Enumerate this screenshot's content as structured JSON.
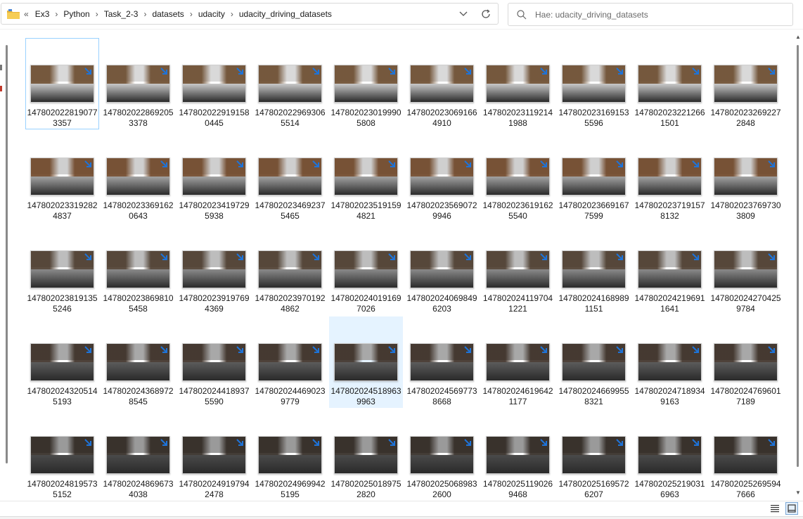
{
  "address_bar": {
    "back_label": "«",
    "crumbs": [
      "Ex3",
      "Python",
      "Task_2-3",
      "datasets",
      "udacity",
      "udacity_driving_datasets"
    ]
  },
  "search": {
    "placeholder": "Hae: udacity_driving_datasets"
  },
  "icons": {
    "folder": "folder-icon",
    "chevron": "chevron-down-icon",
    "refresh": "refresh-icon",
    "search": "search-icon",
    "shortcut": "shortcut-arrow-icon",
    "details_view": "details-view-icon",
    "thumbnail_view": "thumbnail-view-icon"
  },
  "colors": {
    "accent": "#1e73d8",
    "focus_border": "#99d1ff",
    "selection_bg": "#e5f3ff"
  },
  "files": [
    {
      "line1": "147802022819077",
      "line2": "3357"
    },
    {
      "line1": "147802022869205",
      "line2": "3378"
    },
    {
      "line1": "147802022919158",
      "line2": "0445"
    },
    {
      "line1": "147802022969306",
      "line2": "5514"
    },
    {
      "line1": "147802023019990",
      "line2": "5808"
    },
    {
      "line1": "147802023069166",
      "line2": "4910"
    },
    {
      "line1": "147802023119214",
      "line2": "1988"
    },
    {
      "line1": "147802023169153",
      "line2": "5596"
    },
    {
      "line1": "147802023221266",
      "line2": "1501"
    },
    {
      "line1": "147802023269227",
      "line2": "2848"
    },
    {
      "line1": "147802023319282",
      "line2": "4837"
    },
    {
      "line1": "147802023369162",
      "line2": "0643"
    },
    {
      "line1": "147802023419729",
      "line2": "5938"
    },
    {
      "line1": "147802023469237",
      "line2": "5465"
    },
    {
      "line1": "147802023519159",
      "line2": "4821"
    },
    {
      "line1": "147802023569072",
      "line2": "9946"
    },
    {
      "line1": "147802023619162",
      "line2": "5540"
    },
    {
      "line1": "147802023669167",
      "line2": "7599"
    },
    {
      "line1": "147802023719157",
      "line2": "8132"
    },
    {
      "line1": "147802023769730",
      "line2": "3809"
    },
    {
      "line1": "147802023819135",
      "line2": "5246"
    },
    {
      "line1": "147802023869810",
      "line2": "5458"
    },
    {
      "line1": "147802023919769",
      "line2": "4369"
    },
    {
      "line1": "147802023970192",
      "line2": "4862"
    },
    {
      "line1": "147802024019169",
      "line2": "7026"
    },
    {
      "line1": "147802024069849",
      "line2": "6203"
    },
    {
      "line1": "147802024119704",
      "line2": "1221"
    },
    {
      "line1": "147802024168989",
      "line2": "1151"
    },
    {
      "line1": "147802024219691",
      "line2": "1641"
    },
    {
      "line1": "147802024270425",
      "line2": "9784"
    },
    {
      "line1": "147802024320514",
      "line2": "5193"
    },
    {
      "line1": "147802024368972",
      "line2": "8545"
    },
    {
      "line1": "147802024418937",
      "line2": "5590"
    },
    {
      "line1": "147802024469023",
      "line2": "9779"
    },
    {
      "line1": "147802024518963",
      "line2": "9963"
    },
    {
      "line1": "147802024569773",
      "line2": "8668"
    },
    {
      "line1": "147802024619642",
      "line2": "1177"
    },
    {
      "line1": "147802024669955",
      "line2": "8321"
    },
    {
      "line1": "147802024718934",
      "line2": "9163"
    },
    {
      "line1": "147802024769601",
      "line2": "7189"
    },
    {
      "line1": "147802024819573",
      "line2": "5152"
    },
    {
      "line1": "147802024869673",
      "line2": "4038"
    },
    {
      "line1": "147802024919794",
      "line2": "2478"
    },
    {
      "line1": "147802024969942",
      "line2": "5195"
    },
    {
      "line1": "147802025018975",
      "line2": "2820"
    },
    {
      "line1": "147802025068983",
      "line2": "2600"
    },
    {
      "line1": "147802025119026",
      "line2": "9468"
    },
    {
      "line1": "147802025169572",
      "line2": "6207"
    },
    {
      "line1": "147802025219031",
      "line2": "6963"
    },
    {
      "line1": "147802025269594",
      "line2": "7666"
    }
  ],
  "focused_index": 0,
  "selected_index": 34
}
